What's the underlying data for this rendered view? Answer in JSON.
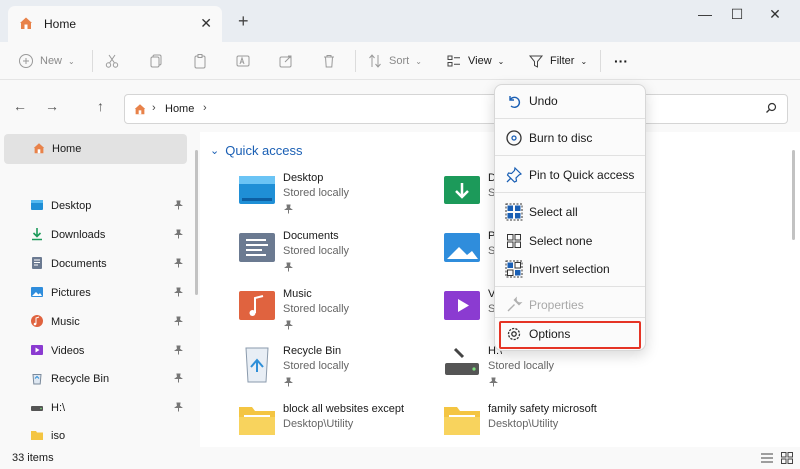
{
  "tab": {
    "title": "Home",
    "close_glyph": "✕",
    "new_glyph": "+"
  },
  "window": {
    "minimize": "—",
    "maximize": "☐",
    "close": "✕"
  },
  "toolbar": {
    "new_label": "New",
    "sort_label": "Sort",
    "view_label": "View",
    "filter_label": "Filter",
    "more_glyph": "···"
  },
  "nav": {
    "back": "←",
    "forward": "→",
    "up": "↑"
  },
  "address": {
    "segment": "Home"
  },
  "sidebar": {
    "home": "Home",
    "items": [
      {
        "label": "Desktop",
        "icon": "desktop-folder-icon"
      },
      {
        "label": "Downloads",
        "icon": "downloads-folder-icon"
      },
      {
        "label": "Documents",
        "icon": "documents-folder-icon"
      },
      {
        "label": "Pictures",
        "icon": "pictures-folder-icon"
      },
      {
        "label": "Music",
        "icon": "music-folder-icon"
      },
      {
        "label": "Videos",
        "icon": "videos-folder-icon"
      },
      {
        "label": "Recycle Bin",
        "icon": "recycle-bin-icon"
      },
      {
        "label": "H:\\",
        "icon": "drive-icon"
      },
      {
        "label": "iso",
        "icon": "folder-icon"
      }
    ]
  },
  "quick_access": {
    "title": "Quick access",
    "items": [
      {
        "name": "Desktop",
        "sub": "Stored locally"
      },
      {
        "name": "D",
        "sub": "S"
      },
      {
        "name": "Documents",
        "sub": "Stored locally"
      },
      {
        "name": "P",
        "sub": "S"
      },
      {
        "name": "Music",
        "sub": "Stored locally"
      },
      {
        "name": "V",
        "sub": "S"
      },
      {
        "name": "Recycle Bin",
        "sub": "Stored locally"
      },
      {
        "name": "H:\\",
        "sub": "Stored locally"
      },
      {
        "name": "block all websites except",
        "sub": "Desktop\\Utility"
      },
      {
        "name": "family safety microsoft",
        "sub": "Desktop\\Utility"
      }
    ]
  },
  "menu": {
    "undo": "Undo",
    "burn": "Burn to disc",
    "pin": "Pin to Quick access",
    "select_all": "Select all",
    "select_none": "Select none",
    "invert": "Invert selection",
    "properties": "Properties",
    "options": "Options"
  },
  "status": {
    "count": "33 items"
  },
  "colors": {
    "accent": "#1a5fb4",
    "highlight": "#e53425",
    "folder": "#f4c542"
  }
}
